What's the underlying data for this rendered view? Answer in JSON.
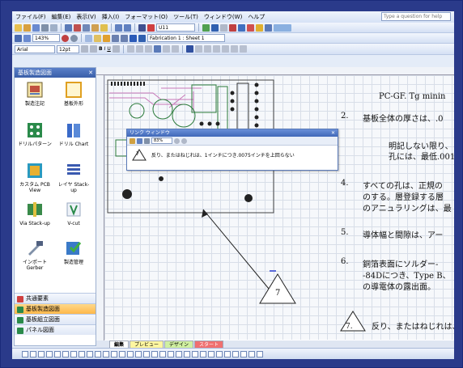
{
  "menu": [
    "ファイル(F)",
    "編集(E)",
    "表示(V)",
    "挿入(I)",
    "フォーマット(O)",
    "ツール(T)",
    "ウィンドウ(W)",
    "ヘルプ"
  ],
  "question_placeholder": "Type a question for help",
  "toolbar1": {
    "style_value": "U11"
  },
  "toolbar2": {
    "zoom": "143%",
    "page_name": "Fabrication 1 : Sheet 1"
  },
  "toolbar3": {
    "font": "Arial",
    "size": "12pt"
  },
  "left_panel": {
    "title": "基板製造図面",
    "shapes": [
      {
        "label": "製造注記"
      },
      {
        "label": "基板外形"
      },
      {
        "label": "ドリルパターン"
      },
      {
        "label": "ドリル Chart"
      },
      {
        "label": "カスタム PCB View"
      },
      {
        "label": "レイヤ Stack-up"
      },
      {
        "label": "Via Stack-up"
      },
      {
        "label": "V-cut"
      },
      {
        "label": "インポートGerber"
      },
      {
        "label": "製造管理"
      }
    ],
    "stencils": [
      "共通要素",
      "基板製造図面",
      "基板組立図面",
      "パネル図面"
    ]
  },
  "document": {
    "title": "PC-GF. Tg minin",
    "items": [
      {
        "num": "2.",
        "text": "基板全体の厚さは、.0"
      },
      {
        "num": "",
        "text": "明記しない限り、"
      },
      {
        "num": "",
        "text": "孔には、最低.001"
      },
      {
        "num": "4.",
        "text": "すべての孔は、正規の"
      },
      {
        "num": "",
        "text": "のする。層登録する層"
      },
      {
        "num": "",
        "text": "のアニュラリングは、最"
      },
      {
        "num": "5.",
        "text": "導体幅と間隙は、アー"
      },
      {
        "num": "6.",
        "text": "銅箔表面にソルダー-"
      },
      {
        "num": "",
        "text": "-84Dにつき、Type B、"
      },
      {
        "num": "",
        "text": "の導電体の露出面。"
      }
    ],
    "flag_label": "7",
    "flag_note": "7.",
    "note7": "反り、またはねじれは、"
  },
  "dialog": {
    "title": "リンク ウィンドウ",
    "zoom": "83%",
    "flag": "7",
    "message": "反り、またはねじれは、1インチにつき.0075インチを上回らない"
  },
  "tabs": [
    "編集",
    "プレビュー",
    "デザイン",
    "スタート"
  ],
  "colors": {
    "accent": "#3a5fa8",
    "frame": "#2a3a8a",
    "selected_stencil": "#ffb84a"
  }
}
